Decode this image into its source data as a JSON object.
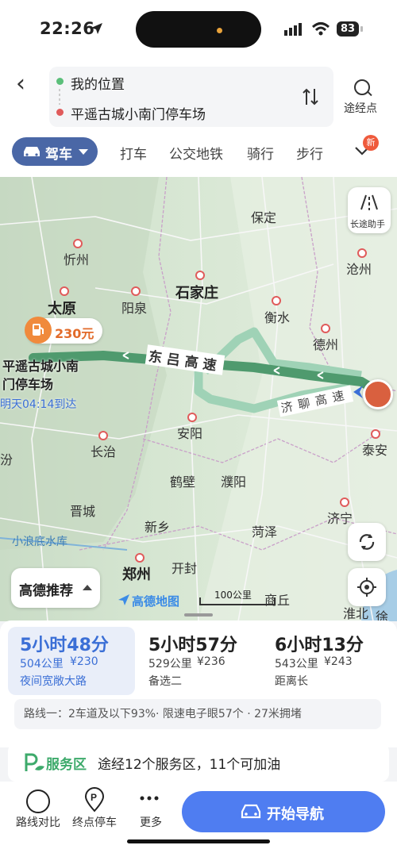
{
  "status_bar": {
    "time": "22:26",
    "battery": "83"
  },
  "header": {
    "origin": "我的位置",
    "destination": "平遥古城小南门停车场",
    "via_label": "途经点"
  },
  "modes": {
    "active": "驾车",
    "tabs": [
      "打车",
      "公交地铁",
      "骑行",
      "步行"
    ],
    "new_badge": "新"
  },
  "map": {
    "cities": {
      "xinzhou": "忻州",
      "baoding": "保定",
      "cangzhou": "沧州",
      "shijiazhuang": "石家庄",
      "taiyuan": "太原",
      "yangquan": "阳泉",
      "hengshui": "衡水",
      "dezhou": "德州",
      "anyang": "安阳",
      "changzhi": "长治",
      "taian": "泰安",
      "hebi": "鹤壁",
      "puyang": "濮阳",
      "jincheng": "晋城",
      "xinxiang": "新乡",
      "heze": "菏泽",
      "jining": "济宁",
      "xiaolangdi": "小浪底水库",
      "zhengzhou": "郑州",
      "kaifeng": "开封",
      "shangqiu": "商丘",
      "huaibei": "淮北",
      "xuzhou": "徐州",
      "fen": "汾"
    },
    "roads": {
      "donglv": "东吕高速",
      "jiliao": "济聊高速"
    },
    "fuel_price": "230元",
    "dest_label_1": "平遥古城小南",
    "dest_label_2": "门停车场",
    "eta": "明天04:14到达",
    "long_trip": "长途助手",
    "recommend": "高德推荐",
    "logo": "高德地图",
    "scale": "100公里"
  },
  "routes": [
    {
      "time": "5小时48分",
      "dist": "504公里",
      "cost": "¥230",
      "tag": "夜间宽敞大路"
    },
    {
      "time": "5小时57分",
      "dist": "529公里",
      "cost": "¥236",
      "tag": "备选二"
    },
    {
      "time": "6小时13分",
      "dist": "543公里",
      "cost": "¥243",
      "tag": "距离长"
    }
  ],
  "route_info": "路线一：2车道及以下93%· 限速电子眼57个 · 27米拥堵",
  "service": {
    "label": "服务区",
    "text": "途经12个服务区，11个可加油"
  },
  "bottom": {
    "compare": "路线对比",
    "parking": "终点停车",
    "more": "更多",
    "start": "开始导航"
  },
  "colors": {
    "accent": "#4f7df1",
    "route_main": "#4f9a6e",
    "route_alt": "#9fd2b6"
  }
}
